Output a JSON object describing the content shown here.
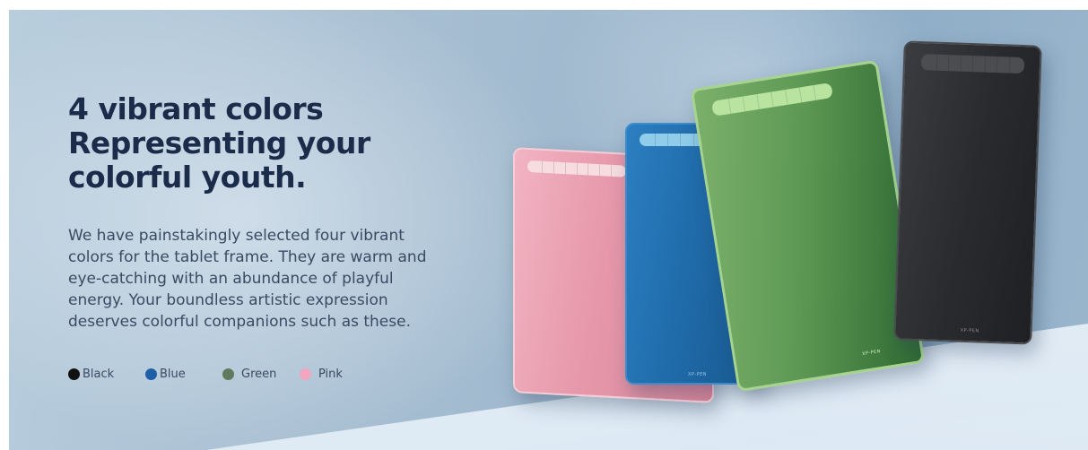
{
  "headline": {
    "line1": "4 vibrant colors",
    "line2": "Representing your",
    "line3": "colorful youth."
  },
  "description": {
    "line1": "We have painstakingly selected four vibrant",
    "line2": "colors for the tablet frame. They are warm and",
    "line3": "eye-catching with an abundance of playful",
    "line4": "energy. Your boundless artistic expression",
    "line5": "deserves colorful companions such as these."
  },
  "swatches": [
    {
      "label": "Black",
      "color": "#111111"
    },
    {
      "label": "Blue",
      "color": "#1f5fa6"
    },
    {
      "label": "Green",
      "color": "#5f7a5e"
    },
    {
      "label": "Pink",
      "color": "#f2a6bf"
    }
  ],
  "tablets": {
    "brand": "XP-PEN"
  },
  "colors": {
    "heading": "#1b2c4a",
    "text": "#3a4a62"
  }
}
